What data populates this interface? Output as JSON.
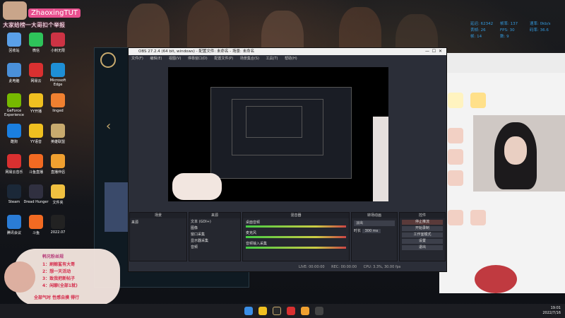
{
  "overlay": {
    "streamer_name": "ZhaoxingTUT",
    "subtitle": "大家给榜一大哥扣个举报",
    "notice_title": "韩兄粉丝规",
    "notice_lines": [
      "1：刷鲸鲨有大哥",
      "2：想一天活动",
      "3：致我把新帖子",
      "4：闲聊(全部1就)"
    ],
    "notice_footer": "全部气时  性感自摸  得行"
  },
  "stats": {
    "rows": [
      [
        "延迟: 62342",
        "帧率: 137",
        "速率: 0kb/s"
      ],
      [
        "丢帧: 26",
        "FPS: 30",
        "码率: 36.6"
      ],
      [
        "帧: 14",
        "数: 9",
        ""
      ]
    ]
  },
  "desktop_icons": [
    {
      "label": "回收站",
      "color": "#5aa0e8"
    },
    {
      "label": "微信",
      "color": "#2ec35a"
    },
    {
      "label": "小刺无限",
      "color": "#cc3344"
    },
    {
      "label": "此电脑",
      "color": "#4a90d9"
    },
    {
      "label": "网易云",
      "color": "#d93030"
    },
    {
      "label": "Microsoft Edge",
      "color": "#1e8fd6"
    },
    {
      "label": "GeForce Experience",
      "color": "#76b900"
    },
    {
      "label": "YY开播",
      "color": "#f0c020"
    },
    {
      "label": "Iinged",
      "color": "#f08030"
    },
    {
      "label": "酷狗",
      "color": "#1a7fe0"
    },
    {
      "label": "YY语音",
      "color": "#f0c020"
    },
    {
      "label": "英雄联盟",
      "color": "#c8aa6e"
    },
    {
      "label": "网易云音乐",
      "color": "#d93030"
    },
    {
      "label": "斗鱼直播",
      "color": "#f26a22"
    },
    {
      "label": "直播伴侣",
      "color": "#f0a030"
    },
    {
      "label": "Steam",
      "color": "#1b2838"
    },
    {
      "label": "Dread Hunger",
      "color": "#303040"
    },
    {
      "label": "文件夹",
      "color": "#f0c040"
    },
    {
      "label": "腾讯会议",
      "color": "#2a7cd6"
    },
    {
      "label": "斗鱼",
      "color": "#f26a22"
    },
    {
      "label": "2022.07",
      "color": "#222"
    }
  ],
  "obs": {
    "title": "OBS 27.2.4 (64 bit, windows) - 配置文件: 未命名 - 场景: 未命名",
    "menu": [
      "文件(F)",
      "编辑(E)",
      "视图(V)",
      "停靠窗口(D)",
      "配置文件(P)",
      "场景集合(S)",
      "工具(T)",
      "帮助(H)"
    ],
    "scene_header": "来源",
    "sources": [
      "文本 (GDI+)",
      "图像",
      "窗口采集",
      "显示器采集",
      "音频"
    ],
    "scenes_dock": "场景",
    "sources_dock": "来源",
    "mixer_dock": "混音器",
    "mixer_rows": [
      "桌面音频",
      "麦克风",
      "音频输入采集"
    ],
    "transitions_dock": "转场动画",
    "transition_value": "淡出",
    "duration_label": "时长",
    "duration_value": "300 ms",
    "controls_dock": "控件",
    "controls": [
      "停止推流",
      "开始录制",
      "工作室模式",
      "设置",
      "退出"
    ],
    "status": [
      "LIVE: 00:00:00",
      "REC: 00:00:00",
      "CPU: 3.3%, 30.00 fps"
    ]
  },
  "taskbar": {
    "time": "19:01",
    "date": "2022/7/16"
  },
  "colors": {
    "accent": "#e8508f",
    "obs_bg": "#2b2e38"
  }
}
